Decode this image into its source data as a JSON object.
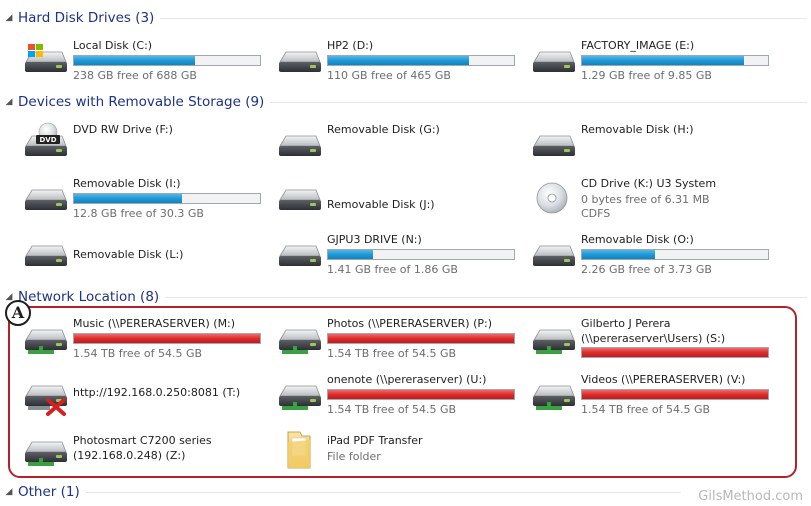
{
  "groups": {
    "hard_disk": {
      "title": "Hard Disk Drives (3)"
    },
    "removable": {
      "title": "Devices with Removable Storage (9)"
    },
    "network": {
      "title": "Network Location (8)"
    },
    "other": {
      "title": "Other (1)"
    }
  },
  "hard_disks": [
    {
      "name": "Local Disk (C:)",
      "free_text": "238 GB free of 688 GB",
      "used_fraction": 0.65,
      "icon": "windows-drive-icon"
    },
    {
      "name": "HP2 (D:)",
      "free_text": "110 GB free of 465 GB",
      "used_fraction": 0.76,
      "icon": "hard-drive-icon"
    },
    {
      "name": "FACTORY_IMAGE (E:)",
      "free_text": "1.29 GB free of 9.85 GB",
      "used_fraction": 0.87,
      "icon": "hard-drive-icon"
    }
  ],
  "removable": [
    {
      "name": "DVD RW Drive (F:)",
      "icon": "dvd-drive-icon"
    },
    {
      "name": "Removable Disk (G:)",
      "icon": "removable-disk-icon"
    },
    {
      "name": "Removable Disk (H:)",
      "icon": "removable-disk-icon"
    },
    {
      "name": "Removable Disk (I:)",
      "free_text": "12.8 GB free of 30.3 GB",
      "used_fraction": 0.58,
      "icon": "removable-disk-icon"
    },
    {
      "name": "Removable Disk (J:)",
      "icon": "removable-disk-icon"
    },
    {
      "name": "CD Drive (K:) U3 System",
      "free_text": "0 bytes free of 6.31 MB",
      "fs_text": "CDFS",
      "icon": "cd-disc-icon"
    },
    {
      "name": "Removable Disk (L:)",
      "icon": "removable-disk-icon"
    },
    {
      "name": "GJPU3 DRIVE (N:)",
      "free_text": "1.41 GB free of 1.86 GB",
      "used_fraction": 0.24,
      "icon": "removable-disk-icon"
    },
    {
      "name": "Removable Disk (O:)",
      "free_text": "2.26 GB free of 3.73 GB",
      "used_fraction": 0.39,
      "icon": "removable-disk-icon"
    }
  ],
  "network": [
    {
      "name": "Music (\\\\PERERASERVER) (M:)",
      "free_text": "1.54 TB free of 54.5 GB",
      "used_fraction": 1.0,
      "icon": "network-drive-icon"
    },
    {
      "name": "Photos (\\\\PERERASERVER) (P:)",
      "free_text": "1.54 TB free of 54.5 GB",
      "used_fraction": 1.0,
      "icon": "network-drive-icon"
    },
    {
      "name": "Gilberto J Perera",
      "name_line2": "(\\\\pereraserver\\Users) (S:)",
      "used_fraction": 1.0,
      "icon": "network-drive-icon"
    },
    {
      "name": "http://192.168.0.250:8081 (T:)",
      "icon": "disconnected-network-drive-icon"
    },
    {
      "name": "onenote (\\\\pereraserver) (U:)",
      "free_text": "1.54 TB free of 54.5 GB",
      "used_fraction": 1.0,
      "icon": "network-drive-icon"
    },
    {
      "name": "Videos (\\\\PERERASERVER) (V:)",
      "free_text": "1.54 TB free of 54.5 GB",
      "used_fraction": 1.0,
      "icon": "network-drive-icon"
    },
    {
      "name": "Photosmart C7200 series",
      "name_line2": "(192.168.0.248) (Z:)",
      "icon": "network-drive-icon"
    },
    {
      "name": "iPad PDF Transfer",
      "free_text": "File folder",
      "icon": "folder-icon"
    }
  ],
  "annotation": {
    "label": "A"
  },
  "watermark": "GilsMethod.com"
}
